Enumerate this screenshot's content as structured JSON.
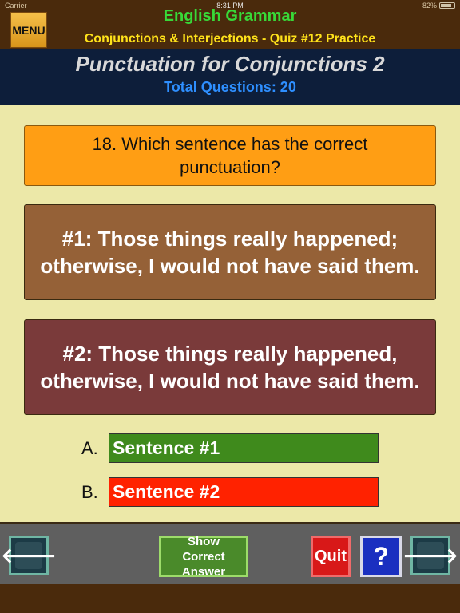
{
  "status_bar": {
    "carrier": "Carrier",
    "time": "8:31 PM",
    "battery": "82%"
  },
  "header": {
    "menu_label": "MENU",
    "app_title": "English Grammar",
    "subtitle": "Conjunctions & Interjections - Quiz #12 Practice"
  },
  "quiz": {
    "title": "Punctuation for Conjunctions 2",
    "total_questions": "Total Questions: 20"
  },
  "question": {
    "text": "18. Which sentence has the correct punctuation?"
  },
  "sentences": [
    {
      "text": "#1:  Those things really happened; otherwise, I would not have said them."
    },
    {
      "text": "#2:  Those things really happened, otherwise, I would not have said them."
    }
  ],
  "answers": [
    {
      "letter": "A.",
      "label": "Sentence #1",
      "color": "#3f8a1c"
    },
    {
      "letter": "B.",
      "label": "Sentence #2",
      "color": "#ff2200"
    }
  ],
  "bottom_bar": {
    "prev_icon": "arrow-left-icon",
    "prev_glyph": "🡐",
    "show_line1": "Show",
    "show_line2": "Correct Answer",
    "quit_label": "Quit",
    "help_label": "?",
    "next_icon": "arrow-right-icon",
    "next_glyph": "🡒"
  },
  "colors": {
    "header_bg": "#4a2a0c",
    "title_band_bg": "#0d1e3a",
    "content_bg": "#ece8a8",
    "question_bg": "#ff9e14",
    "sentence1_bg": "#956137",
    "sentence2_bg": "#7a3a3a"
  }
}
